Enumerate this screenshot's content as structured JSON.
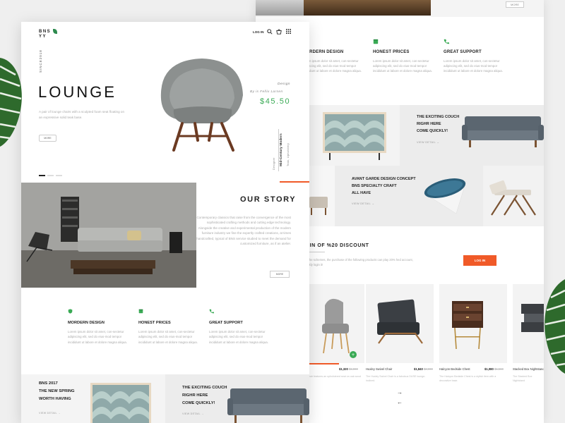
{
  "colors": {
    "accent_green": "#3aaa55",
    "accent_orange": "#f05a28",
    "background": "#efefef"
  },
  "back_page": {
    "top_strip": {
      "button_label": "MORE"
    },
    "features": [
      {
        "icon": "shield-icon",
        "title": "MORDERN DESIGN",
        "text": "Lorem ipsum dolor sit amet, con-sectetur adipiscing elit, sed do eius-mod tempor incididunt ut labore et dolore magna aliqua."
      },
      {
        "icon": "box-icon",
        "title": "HONEST PRICES",
        "text": "Lorem ipsum dolor sit amet, con-sectetur adipiscing elit, sed do eius-mod tempor incididunt ut labore et dolore magna aliqua."
      },
      {
        "icon": "phone-icon",
        "title": "GREAT SUPPORT",
        "text": "Lorem ipsum dolor sit amet, con-sectetur adipiscing elit, sed do eius-mod tempor incididunt ut labore et dolore magna aliqua."
      }
    ],
    "promos": [
      {
        "lines": [
          "THE EXCITING COUCH",
          "RIGHR HERE",
          "COME QUICKLY!"
        ],
        "link": "VIEW DETAIL →"
      },
      {
        "lines": [
          "AVANT GARDE DESIGN CONCEPT",
          "BNS SPECIALTY CRAFT",
          "ALL HAVE"
        ],
        "link": "VIEW DETAIL →"
      }
    ],
    "discount": {
      "title": "G IN OF %20 DISCOUNT",
      "text": "ing the schemes, the purchase of the following products can play 20% hed account, quickly login it!",
      "login_label": "LOG IN"
    },
    "products": [
      {
        "name": "Hux Chair",
        "price": "$1,320",
        "old_price": "$1,800",
        "desc": "The Hux Chair features an upholstered seat on oak wood legs."
      },
      {
        "name": "Huxley Swivel Chair",
        "price": "$1,840",
        "old_price": "$2,000",
        "desc": "The Huxley Swivel Chair is a fabulous DUSE lounge-inclined."
      },
      {
        "name": "Halcyon Bedside Chest",
        "price": "$1,080",
        "old_price": "$1,560",
        "desc": "The Halcyon Bedside Chest is a stylish item with a decorative base."
      },
      {
        "name": "Stacked Box Nightstand",
        "price": "",
        "old_price": "",
        "desc": "The Stacked Box Nightstand"
      }
    ],
    "arrows": {
      "next": "→",
      "prev": "←"
    }
  },
  "front_page": {
    "logo_top": "BNS",
    "logo_bottom": "YY",
    "nav": {
      "login": "LOG IN"
    },
    "side_label": "SINCE2018",
    "hero": {
      "title": "LOUNGE",
      "description": "A pair of lounge chairs with a sculpted foam seat floating on an expressive solid teak base.",
      "button": "MORE",
      "design_label": "Design",
      "designer": "By is Fellix Larsen",
      "price": "$45.50",
      "vertical_main": "Mid-Century Modern",
      "vertical_sub": "Teak, Upholstery",
      "vertical_sub2": "Designer"
    },
    "story": {
      "title": "OUR STORY",
      "text": "Contemporary classics that raise from the convergence of the most sophisticated crafting methods and cutting edge technology. Alongside the creative and experimental production of the modern furniture industry we fine the expertly crafted creations, at times handcrafted, typical of BNS service studied to meet the demand for customized furniture, as if an atelier.",
      "button": "MORE"
    },
    "features": [
      {
        "icon": "shield-icon",
        "title": "MORDERN DESIGN",
        "text": "Lorem ipsum dolor sit amet, con-sectetur adipiscing elit, sed do eius-mod tempor incididunt ut labore et dolore magna aliqua."
      },
      {
        "icon": "box-icon",
        "title": "HONEST PRICES",
        "text": "Lorem ipsum dolor sit amet, con-sectetur adipiscing elit, sed do eius-mod tempor incididunt ut labore et dolore magna aliqua."
      },
      {
        "icon": "phone-icon",
        "title": "GREAT SUPPORT",
        "text": "Lorem ipsum dolor sit amet, con-sectetur adipiscing elit, sed do eius-mod tempor incididunt ut labore et dolore magna aliqua."
      }
    ],
    "promos": [
      {
        "lines": [
          "BNS 2017",
          "THE NEW SPRING",
          "WORTH HAVING"
        ],
        "link": "VIEW DETAIL →"
      },
      {
        "lines": [
          "THE EXCITING COUCH",
          "RIGHR HERE",
          "COME QUICKLY!"
        ],
        "link": "VIEW DETAIL →"
      }
    ]
  }
}
